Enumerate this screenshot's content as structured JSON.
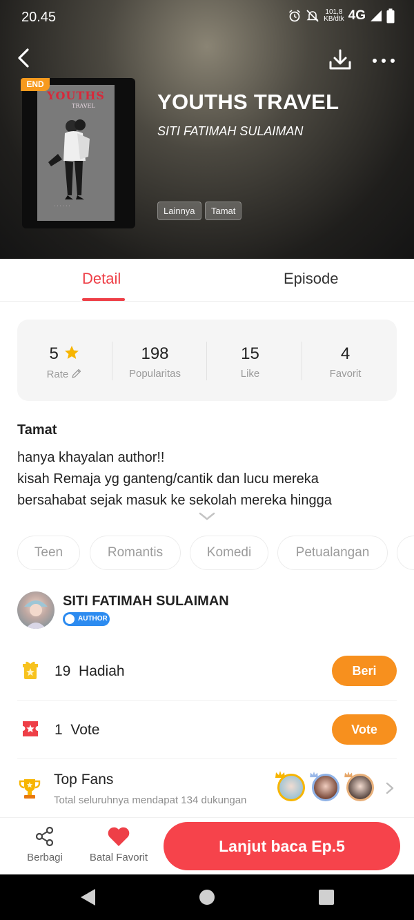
{
  "status_bar": {
    "time": "20.45",
    "speed_value": "101,8",
    "speed_unit": "KB/dtk",
    "network": "4G"
  },
  "header": {
    "badge": "END",
    "cover_title": "YOUTHS",
    "cover_subtitle": "TRAVEL",
    "title": "YOUTHS TRAVEL",
    "author": "SITI FATIMAH SULAIMAN",
    "tags": [
      "Lainnya",
      "Tamat"
    ]
  },
  "tabs": {
    "detail": "Detail",
    "episode": "Episode",
    "active": "Detail"
  },
  "stats": [
    {
      "value": "5",
      "label": "Rate"
    },
    {
      "value": "198",
      "label": "Popularitas"
    },
    {
      "value": "15",
      "label": "Like"
    },
    {
      "value": "4",
      "label": "Favorit"
    }
  ],
  "description": {
    "status": "Tamat",
    "lines": [
      "hanya khayalan author!!",
      "kisah Remaja yg ganteng/cantik dan lucu mereka",
      "bersahabat sejak masuk ke sekolah mereka hingga"
    ]
  },
  "genres": [
    "Teen",
    "Romantis",
    "Komedi",
    "Petualangan"
  ],
  "author_section": {
    "name": "SITI FATIMAH SULAIMAN",
    "badge": "AUTHOR"
  },
  "gift": {
    "count": "19",
    "label": "Hadiah",
    "button": "Beri"
  },
  "vote": {
    "count": "1",
    "label": "Vote",
    "button": "Vote"
  },
  "top_fans": {
    "title": "Top Fans",
    "subtitle": "Total seluruhnya mendapat 134 dukungan"
  },
  "actions": {
    "share": "Berbagi",
    "unfavorite": "Batal Favorit",
    "continue": "Lanjut baca Ep.5"
  },
  "colors": {
    "accent_red": "#ee3f47",
    "orange": "#f7901e",
    "cta_red": "#f6434b",
    "star": "#f7b500"
  }
}
